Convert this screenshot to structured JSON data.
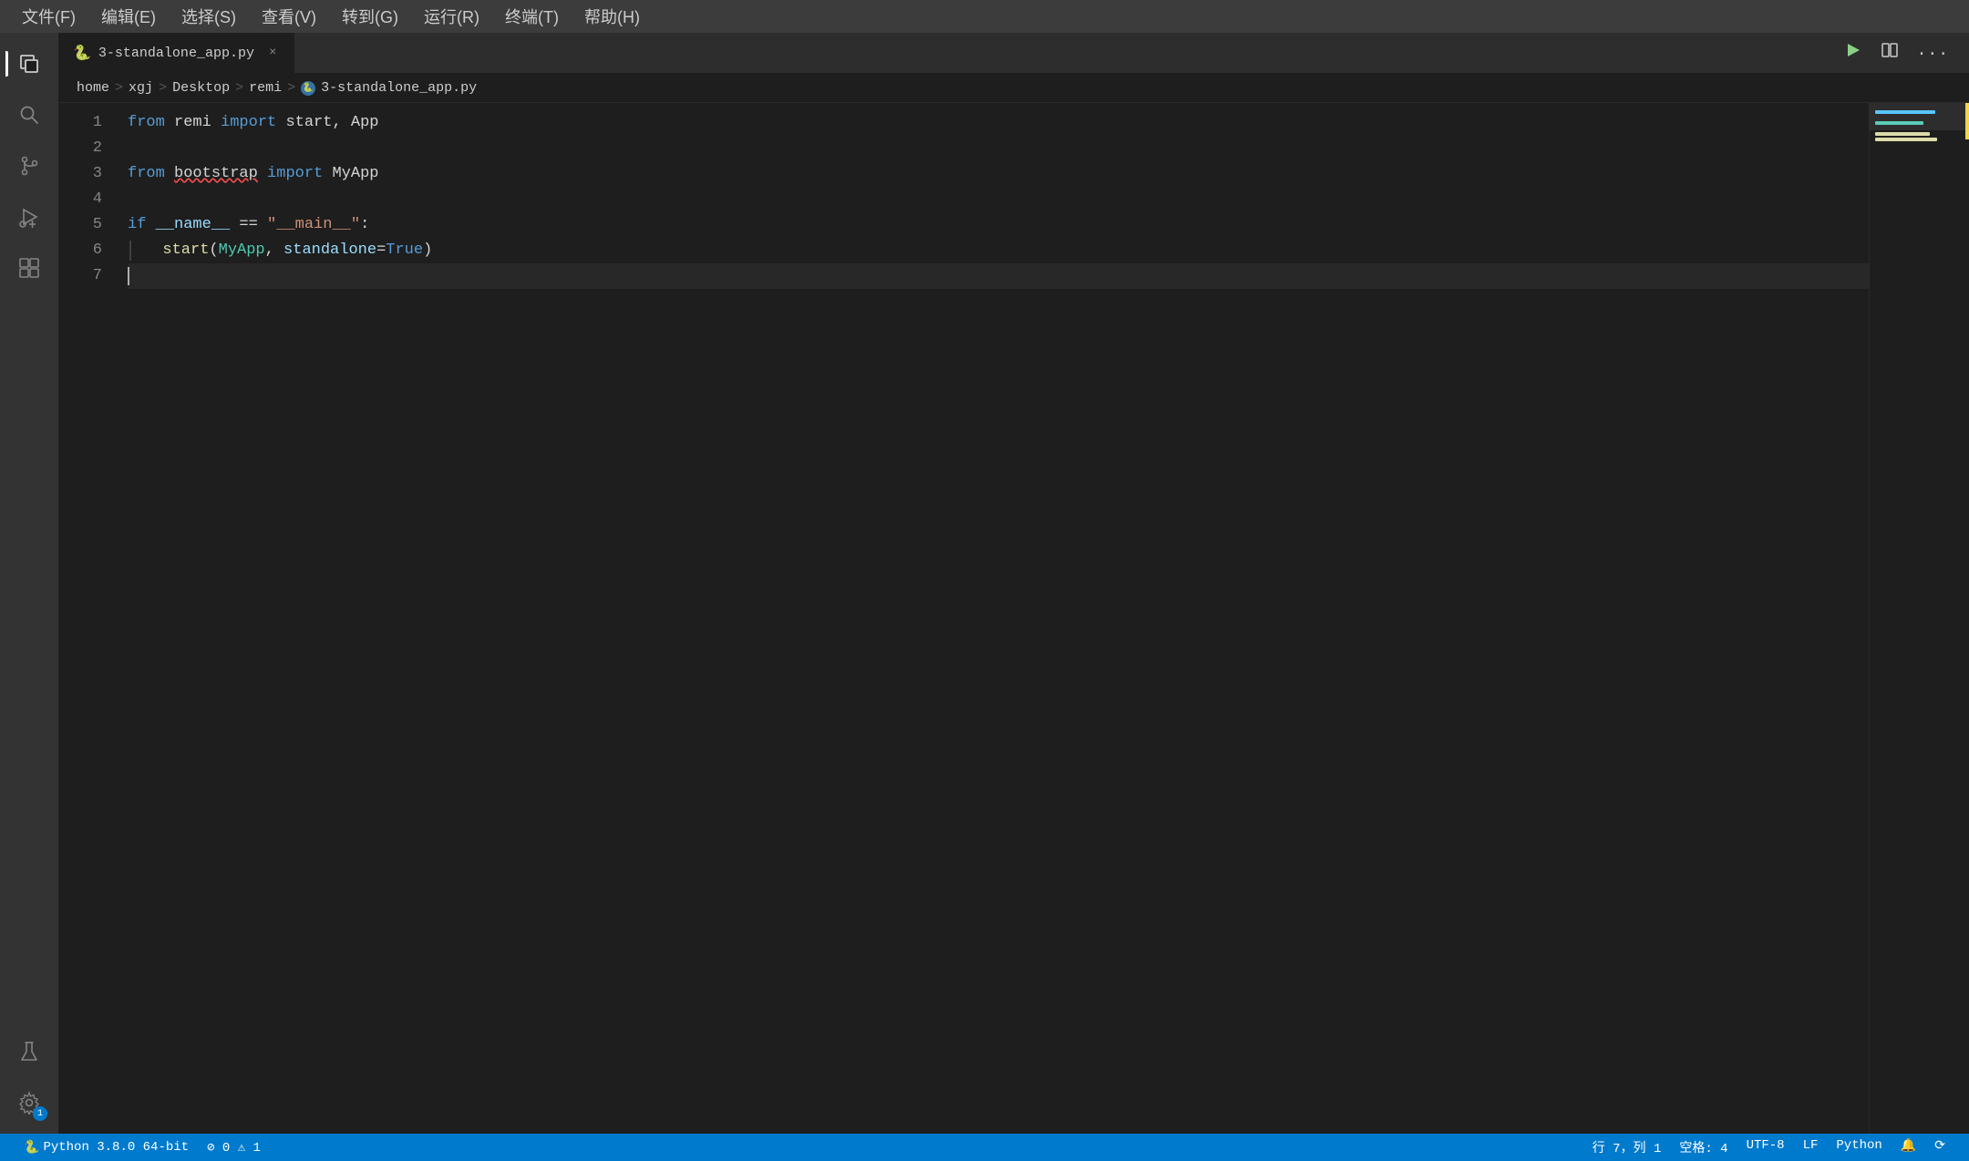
{
  "menubar": {
    "items": [
      {
        "label": "文件(F)",
        "id": "file"
      },
      {
        "label": "编辑(E)",
        "id": "edit"
      },
      {
        "label": "选择(S)",
        "id": "select"
      },
      {
        "label": "查看(V)",
        "id": "view"
      },
      {
        "label": "转到(G)",
        "id": "goto"
      },
      {
        "label": "运行(R)",
        "id": "run"
      },
      {
        "label": "终端(T)",
        "id": "terminal"
      },
      {
        "label": "帮助(H)",
        "id": "help"
      }
    ]
  },
  "activity_bar": {
    "icons": [
      {
        "id": "explorer",
        "symbol": "⬜",
        "active": true,
        "title": "资源管理器"
      },
      {
        "id": "search",
        "symbol": "🔍",
        "active": false,
        "title": "搜索"
      },
      {
        "id": "source-control",
        "symbol": "⑂",
        "active": false,
        "title": "源代码管理"
      },
      {
        "id": "run-debug",
        "symbol": "▷",
        "active": false,
        "title": "运行和调试"
      },
      {
        "id": "extensions",
        "symbol": "⊞",
        "active": false,
        "title": "扩展"
      }
    ],
    "bottom_icons": [
      {
        "id": "flask",
        "symbol": "⚗",
        "active": false,
        "title": "测试"
      },
      {
        "id": "settings",
        "symbol": "⚙",
        "active": false,
        "title": "管理",
        "badge": "1"
      }
    ]
  },
  "tab": {
    "icon": "🐍",
    "filename": "3-standalone_app.py",
    "close_symbol": "×"
  },
  "toolbar": {
    "run_label": "▶",
    "split_label": "⧉",
    "more_label": "···"
  },
  "breadcrumb": {
    "items": [
      "home",
      "xgj",
      "Desktop",
      "remi",
      "3-standalone_app.py"
    ]
  },
  "code": {
    "lines": [
      {
        "num": 1,
        "tokens": [
          {
            "text": "from",
            "cls": "kw"
          },
          {
            "text": " remi ",
            "cls": "plain"
          },
          {
            "text": "import",
            "cls": "kw"
          },
          {
            "text": " start, App",
            "cls": "plain"
          }
        ]
      },
      {
        "num": 2,
        "tokens": []
      },
      {
        "num": 3,
        "tokens": [
          {
            "text": "from",
            "cls": "kw"
          },
          {
            "text": " ",
            "cls": "plain"
          },
          {
            "text": "bootstrap",
            "cls": "plain bootstrap-underline"
          },
          {
            "text": " ",
            "cls": "plain"
          },
          {
            "text": "import",
            "cls": "kw"
          },
          {
            "text": " MyApp",
            "cls": "plain"
          }
        ]
      },
      {
        "num": 4,
        "tokens": []
      },
      {
        "num": 5,
        "tokens": [
          {
            "text": "if",
            "cls": "kw"
          },
          {
            "text": " ",
            "cls": "plain"
          },
          {
            "text": "__name__",
            "cls": "dunder"
          },
          {
            "text": " == ",
            "cls": "plain"
          },
          {
            "text": "\"__main__\"",
            "cls": "string"
          },
          {
            "text": ":",
            "cls": "plain"
          }
        ]
      },
      {
        "num": 6,
        "tokens": [
          {
            "text": "    ",
            "cls": "plain"
          },
          {
            "text": "start",
            "cls": "func"
          },
          {
            "text": "(",
            "cls": "plain"
          },
          {
            "text": "MyApp",
            "cls": "cls"
          },
          {
            "text": ", ",
            "cls": "plain"
          },
          {
            "text": "standalone",
            "cls": "param"
          },
          {
            "text": "=",
            "cls": "plain"
          },
          {
            "text": "True",
            "cls": "bool"
          },
          {
            "text": ")",
            "cls": "plain"
          }
        ],
        "has_indent_guide": true
      },
      {
        "num": 7,
        "tokens": [],
        "active": true
      }
    ]
  },
  "minimap": {
    "lines": [
      {
        "type": "blue",
        "width": "68%"
      },
      {
        "type": "empty",
        "width": "0%"
      },
      {
        "type": "blue",
        "width": "55%"
      },
      {
        "type": "empty",
        "width": "0%"
      },
      {
        "type": "yellow",
        "width": "62%"
      },
      {
        "type": "yellow",
        "width": "70%"
      },
      {
        "type": "empty",
        "width": "0%"
      }
    ]
  },
  "statusbar": {
    "left": [
      {
        "id": "python-version",
        "text": "Python 3.8.0 64-bit"
      },
      {
        "id": "errors",
        "text": "⊘ 0  ⚠ 1"
      }
    ],
    "right": [
      {
        "id": "line-col",
        "text": "行 7，列 1"
      },
      {
        "id": "spaces",
        "text": "空格: 4"
      },
      {
        "id": "encoding",
        "text": "UTF-8"
      },
      {
        "id": "line-ending",
        "text": "LF"
      },
      {
        "id": "language",
        "text": "Python"
      },
      {
        "id": "notif",
        "text": "🔔"
      },
      {
        "id": "sync",
        "text": "⟳"
      }
    ]
  }
}
